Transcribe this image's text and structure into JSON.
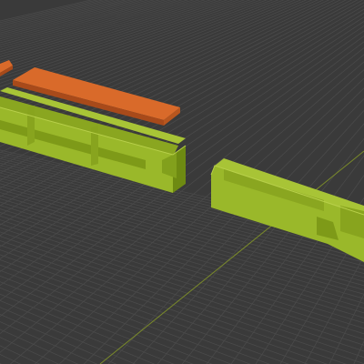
{
  "viewport": {
    "kind": "3d-viewport",
    "background_color": "#3a3a3a",
    "grid_color": "#4a4a4a",
    "axis_color": "#7a8a2a"
  },
  "objects": [
    {
      "name": "orange-strip-small",
      "color": "#d96a2a",
      "shade": "#a84a1a"
    },
    {
      "name": "orange-strip",
      "color": "#d96a2a",
      "shade": "#a84a1a"
    },
    {
      "name": "green-channel-left",
      "color": "#9ab82a",
      "shade": "#6e8a12"
    },
    {
      "name": "green-channel-right",
      "color": "#9ab82a",
      "shade": "#6e8a12"
    }
  ]
}
